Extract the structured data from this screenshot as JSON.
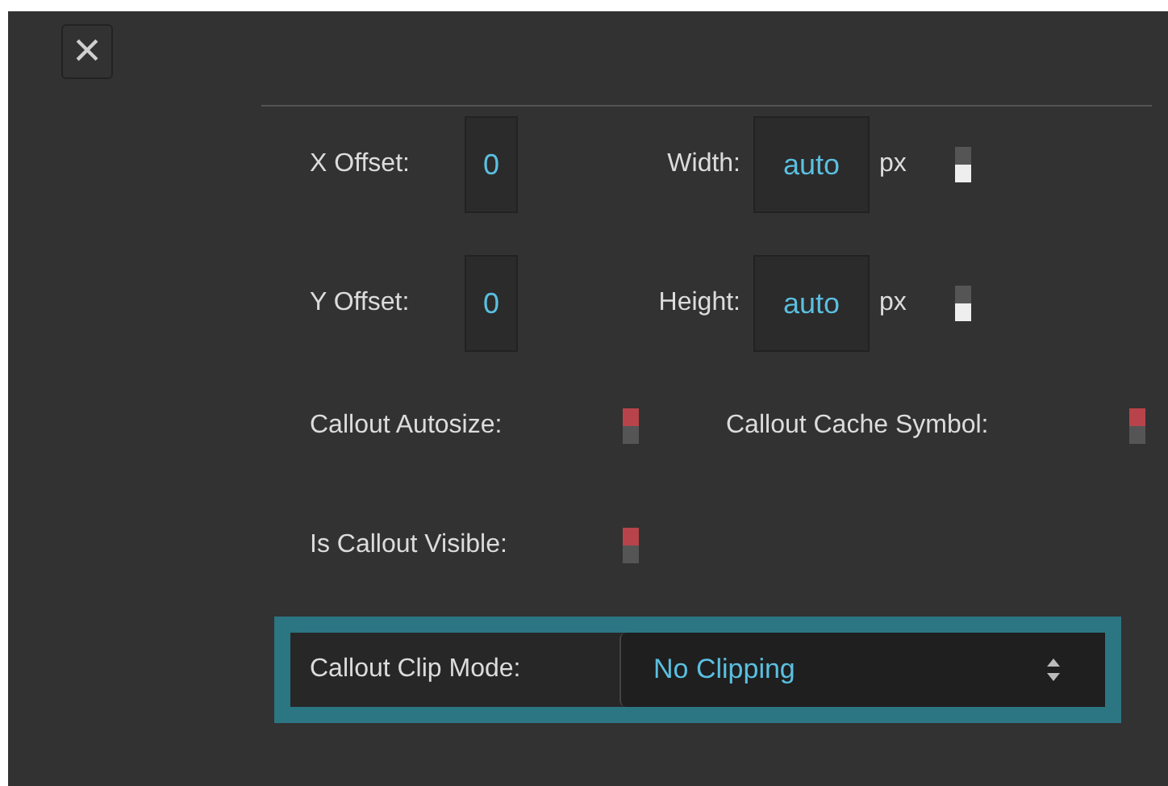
{
  "close_button": {
    "label": "×"
  },
  "offset_rows": [
    {
      "offset_label": "X Offset:",
      "offset_value": "0",
      "size_label": "Width:",
      "size_value": "auto",
      "unit": "px",
      "toggle_on": false
    },
    {
      "offset_label": "Y Offset:",
      "offset_value": "0",
      "size_label": "Height:",
      "size_value": "auto",
      "unit": "px",
      "toggle_on": false
    }
  ],
  "toggles": [
    {
      "label": "Callout Autosize:",
      "on": true
    },
    {
      "label": "Callout Cache Symbol:",
      "on": true
    },
    {
      "label": "Is Callout Visible:",
      "on": true
    }
  ],
  "clip_mode": {
    "label": "Callout Clip Mode:",
    "value": "No Clipping",
    "focused": true
  }
}
